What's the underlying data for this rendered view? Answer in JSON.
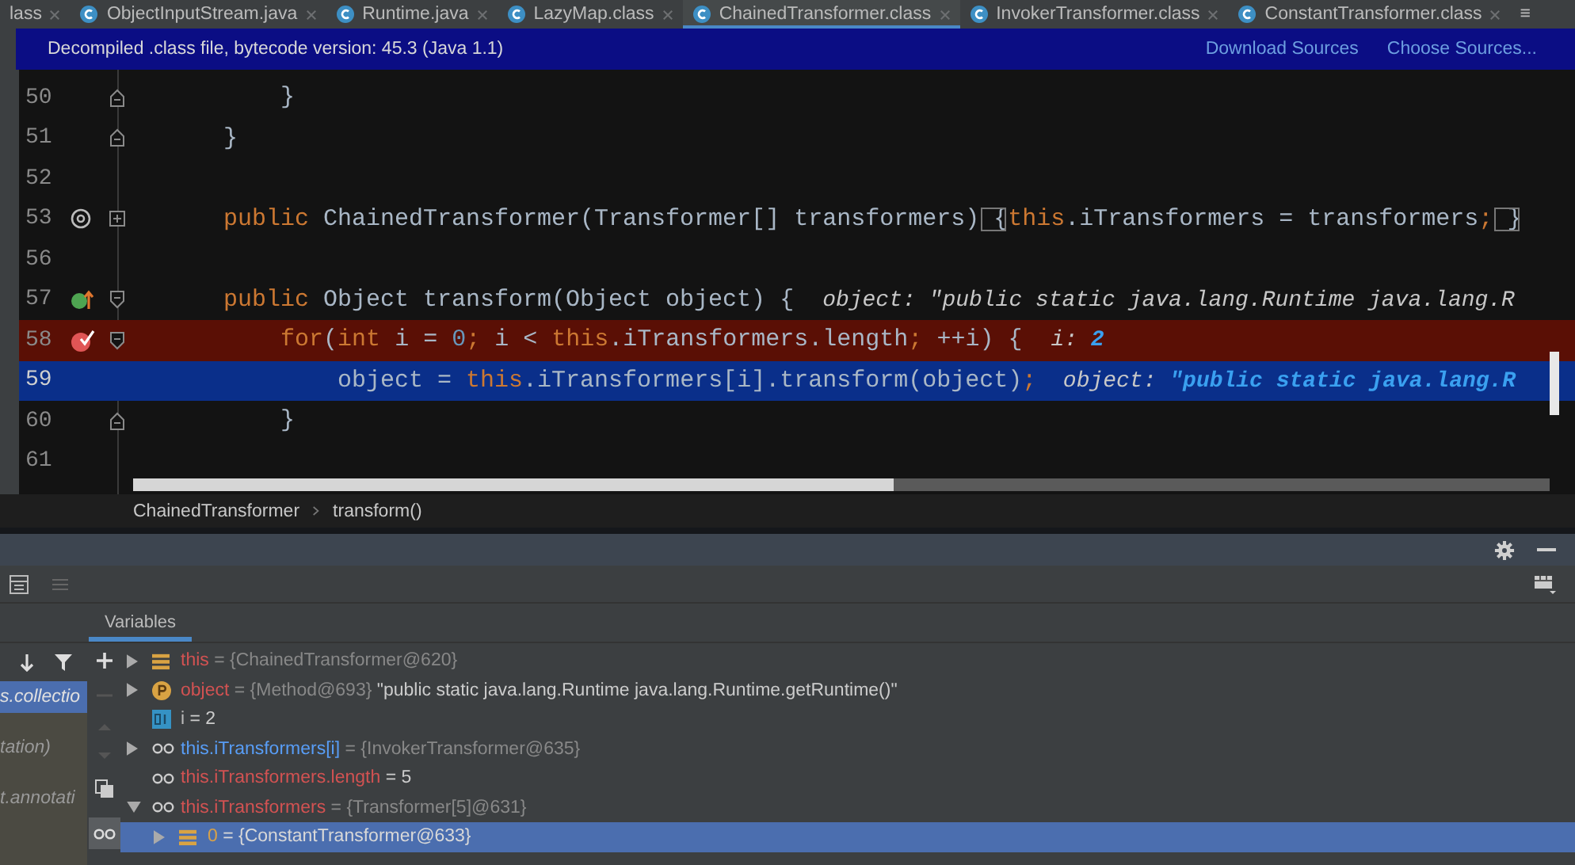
{
  "tabs": [
    {
      "label": "lass",
      "selected": false
    },
    {
      "label": "ObjectInputStream.java",
      "selected": false,
      "kind": "class"
    },
    {
      "label": "Runtime.java",
      "selected": false,
      "kind": "class"
    },
    {
      "label": "LazyMap.class",
      "selected": false,
      "kind": "class"
    },
    {
      "label": "ChainedTransformer.class",
      "selected": true,
      "kind": "class"
    },
    {
      "label": "InvokerTransformer.class",
      "selected": false,
      "kind": "class"
    },
    {
      "label": "ConstantTransformer.class",
      "selected": false,
      "kind": "class"
    }
  ],
  "tab_overflow": "≡",
  "banner": {
    "text": "Decompiled .class file, bytecode version: 45.3 (Java 1.1)",
    "links": [
      "Download Sources",
      "Choose Sources..."
    ]
  },
  "code_lines": [
    {
      "number": "50",
      "kind": "normal",
      "fold": {
        "kind": "end"
      },
      "segments": [
        {
          "t": "        }",
          "kind": "plain"
        }
      ]
    },
    {
      "number": "51",
      "kind": "normal",
      "fold": {
        "kind": "end"
      },
      "segments": [
        {
          "t": "    }",
          "kind": "plain"
        }
      ]
    },
    {
      "number": "52",
      "kind": "normal"
    },
    {
      "number": "53",
      "kind": "normal",
      "marker": {
        "kind": "annotation"
      },
      "fold": {
        "kind": "collapsed"
      },
      "segments": [
        {
          "t": "    public",
          "kind": "keyword"
        },
        {
          "t": " ChainedTransformer(Transformer[] transformers)",
          "kind": "plain"
        },
        {
          "t": " {",
          "kind": "boxed"
        },
        {
          "t": "this",
          "kind": "keyword"
        },
        {
          "t": ".iTransformers = transformers",
          "kind": "plain"
        },
        {
          "t": ";",
          "kind": "keyword"
        },
        {
          "t": " }",
          "kind": "boxed"
        }
      ]
    },
    {
      "number": "56",
      "kind": "normal"
    },
    {
      "number": "57",
      "kind": "normal",
      "marker": {
        "kind": "override"
      },
      "fold": {
        "kind": "start"
      },
      "segments": [
        {
          "t": "    public",
          "kind": "keyword"
        },
        {
          "t": " Object transform(Object object) {  ",
          "kind": "plain"
        },
        {
          "t": "object: \"public static java.lang.Runtime java.lang.R",
          "kind": "hint"
        }
      ]
    },
    {
      "number": "58",
      "kind": "breakpoint",
      "marker": {
        "kind": "breakpoint"
      },
      "fold": {
        "kind": "start"
      },
      "segments": [
        {
          "t": "        for",
          "kind": "keyword"
        },
        {
          "t": "(",
          "kind": "plain"
        },
        {
          "t": "int",
          "kind": "keyword"
        },
        {
          "t": " i = ",
          "kind": "plain"
        },
        {
          "t": "0",
          "kind": "number"
        },
        {
          "t": ";",
          "kind": "keyword"
        },
        {
          "t": " i < ",
          "kind": "plain"
        },
        {
          "t": "this",
          "kind": "keyword"
        },
        {
          "t": ".iTransformers.length",
          "kind": "plain"
        },
        {
          "t": ";",
          "kind": "keyword"
        },
        {
          "t": " ++i) {  ",
          "kind": "plain"
        },
        {
          "t": "i: ",
          "kind": "hint"
        },
        {
          "t": "2",
          "kind": "hint_value"
        }
      ]
    },
    {
      "number": "59",
      "kind": "execution",
      "segments": [
        {
          "t": "            object = ",
          "kind": "plain"
        },
        {
          "t": "this",
          "kind": "keyword"
        },
        {
          "t": ".iTransformers[i].transform(object)",
          "kind": "plain"
        },
        {
          "t": ";",
          "kind": "keyword"
        },
        {
          "t": "  object: ",
          "kind": "hint"
        },
        {
          "t": "\"public static java.lang.R",
          "kind": "hint_value"
        }
      ]
    },
    {
      "number": "60",
      "kind": "normal",
      "fold": {
        "kind": "end"
      },
      "segments": [
        {
          "t": "        }",
          "kind": "plain"
        }
      ]
    },
    {
      "number": "61",
      "kind": "normal"
    }
  ],
  "breadcrumb": [
    "ChainedTransformer",
    "transform()"
  ],
  "frames": [
    {
      "label": "s.collectio",
      "selected": true
    },
    {
      "label": "tation)",
      "selected": false
    },
    {
      "label": "t.annotati",
      "selected": false
    }
  ],
  "variables_tab": {
    "label": "Variables",
    "selected": true
  },
  "variables": [
    {
      "kind": "field",
      "name": "this",
      "color": "#d25252",
      "ref": " = {ChainedTransformer@620}",
      "expanded": false,
      "selected": false
    },
    {
      "kind": "param",
      "name": "object",
      "color": "#d25252",
      "ref": " = {Method@693}",
      "value": " \"public static java.lang.Runtime java.lang.Runtime.getRuntime()\"",
      "expanded": false,
      "selected": false
    },
    {
      "kind": "primitive",
      "name": "i",
      "color": "#bbbbbb",
      "value": " = 2",
      "selected": false
    },
    {
      "kind": "watch",
      "name": "this.iTransformers[i]",
      "color": "#589df6",
      "ref": " = {InvokerTransformer@635}",
      "expanded": false,
      "selected": false
    },
    {
      "kind": "watch",
      "name": "this.iTransformers.length",
      "color": "#d25252",
      "value": " = 5",
      "selected": false
    },
    {
      "kind": "watch",
      "name": "this.iTransformers",
      "color": "#d25252",
      "ref": " = {Transformer[5]@631}",
      "expanded": true,
      "selected": false,
      "children": [
        {
          "kind": "field",
          "name": "0",
          "color": "#d6a14a",
          "ref": " = {ConstantTransformer@633}",
          "expanded": false,
          "selected": true
        }
      ]
    }
  ]
}
